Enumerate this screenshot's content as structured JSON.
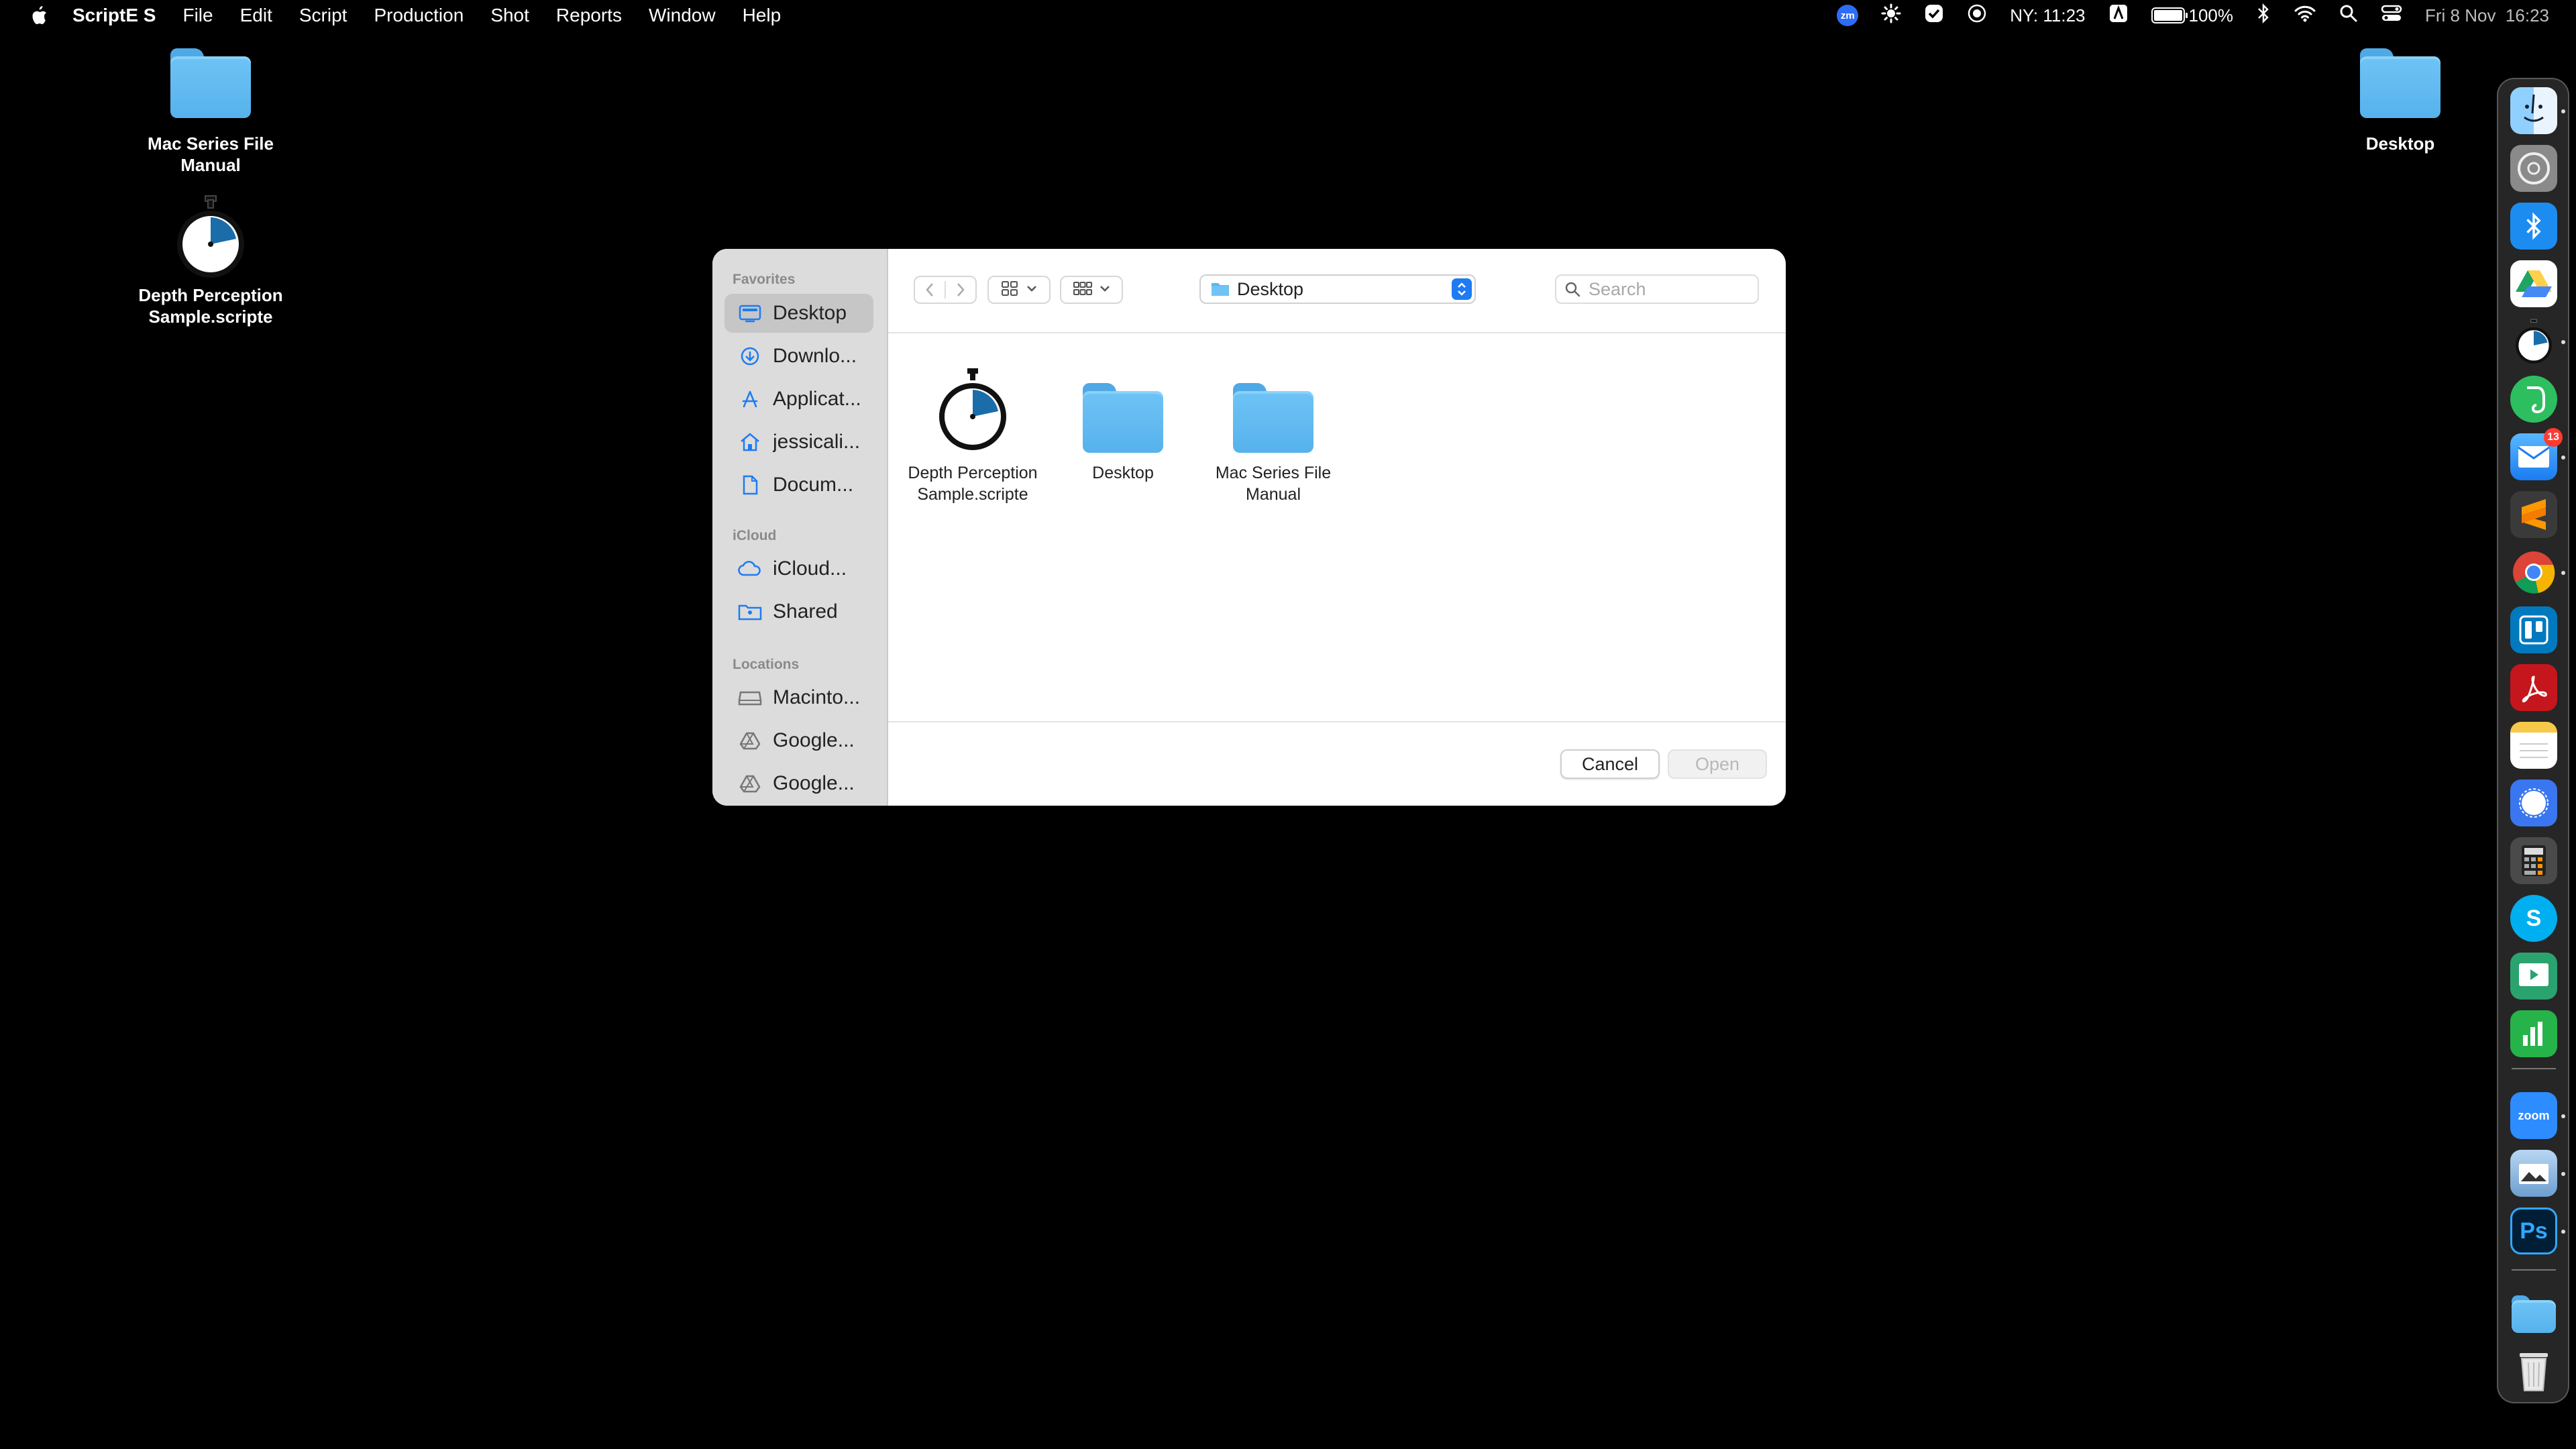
{
  "menubar": {
    "app_name": "ScriptE S",
    "menus": [
      "File",
      "Edit",
      "Script",
      "Production",
      "Shot",
      "Reports",
      "Window",
      "Help"
    ],
    "zoom_badge": "zm",
    "world_clock": "NY: 11:23",
    "battery": "100%",
    "battery_level": 1.0,
    "datetime": "Fri 8 Nov  16:23"
  },
  "desktop_icons": {
    "mac_series": "Mac Series File\nManual",
    "depth_perception": "Depth Perception\nSample.scripte",
    "desktop_folder": "Desktop"
  },
  "dialog": {
    "sidebar": {
      "favorites_header": "Favorites",
      "favorites": [
        "Desktop",
        "Downlo...",
        "Applicat...",
        "jessicali...",
        "Docum..."
      ],
      "icloud_header": "iCloud",
      "icloud": [
        "iCloud...",
        "Shared"
      ],
      "locations_header": "Locations",
      "locations": [
        "Macinto...",
        "Google...",
        "Google..."
      ]
    },
    "location": "Desktop",
    "search_placeholder": "Search",
    "files": [
      {
        "name": "Depth Perception Sample.scripte",
        "kind": "stopwatch-icon"
      },
      {
        "name": "Desktop",
        "kind": "folder-icon"
      },
      {
        "name": "Mac Series File Manual",
        "kind": "folder-icon"
      }
    ],
    "cancel_label": "Cancel",
    "open_label": "Open"
  },
  "dock": {
    "apps": [
      "Finder",
      "System Settings",
      "Bluetooth",
      "Google Drive",
      "ScriptE",
      "Evernote",
      "Mail",
      "Sublime Text",
      "Chrome",
      "Trello",
      "Acrobat",
      "Notes",
      "Signal",
      "Calculator",
      "Skype",
      "Screen",
      "Numbers",
      "Zoom",
      "Preview",
      "Photoshop",
      "Downloads",
      "Trash"
    ],
    "mail_badge": "13",
    "zoom_label": "zoom",
    "photoshop_label": "Ps",
    "skype_label": "S"
  },
  "colors": {
    "accent": "#1f7bf2",
    "folder": "#5ab5ee",
    "sidebar_bg": "#dcdcdc",
    "selected_bg": "#c6c6c6"
  }
}
